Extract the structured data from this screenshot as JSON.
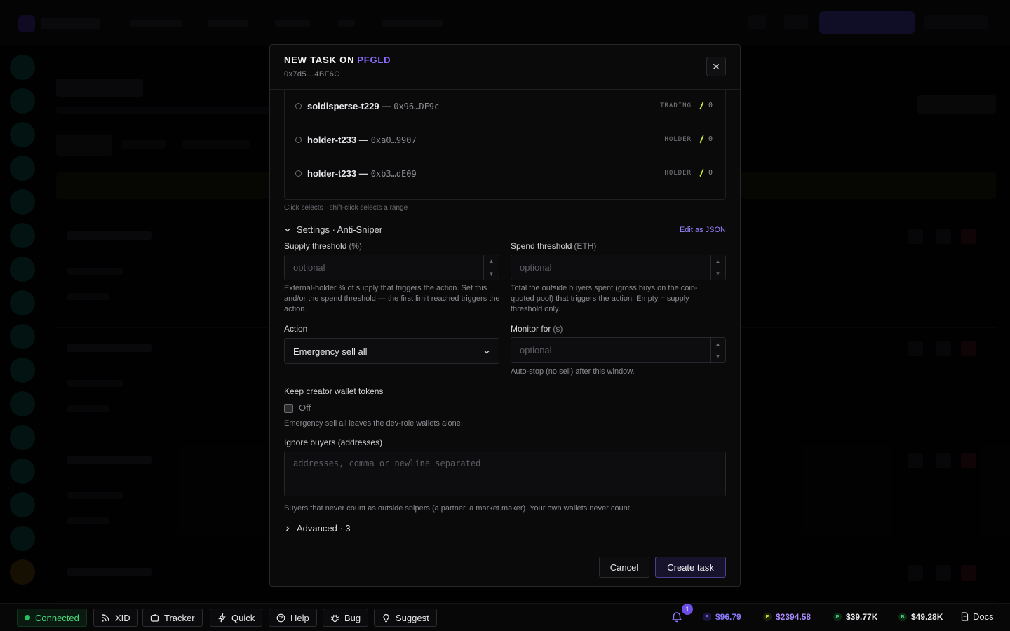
{
  "modal": {
    "title_prefix": "NEW TASK ON",
    "ticker": "PFGLD",
    "address": "0x7d5…4BF6C",
    "close_glyph": "✕"
  },
  "wallets": [
    {
      "name": "soldisperse-t229",
      "dash": "—",
      "address": "0x96…DF9c",
      "role": "TRADING",
      "balance": "0"
    },
    {
      "name": "holder-t233",
      "dash": "—",
      "address": "0xa0…9907",
      "role": "HOLDER",
      "balance": "0"
    },
    {
      "name": "holder-t233",
      "dash": "—",
      "address": "0xb3…dE09",
      "role": "HOLDER",
      "balance": "0"
    }
  ],
  "hint": "Click selects · shift-click selects a range",
  "settings": {
    "label": "Settings · Anti-Sniper",
    "edit_json": "Edit as JSON",
    "supply_threshold": {
      "label": "Supply threshold",
      "unit": "(%)",
      "placeholder": "optional",
      "help": "External-holder % of supply that triggers the action. Set this and/or the spend threshold — the first limit reached triggers the action."
    },
    "spend_threshold": {
      "label": "Spend threshold",
      "unit": "(ETH)",
      "placeholder": "optional",
      "help": "Total the outside buyers spent (gross buys on the coin-quoted pool) that triggers the action. Empty = supply threshold only."
    },
    "action": {
      "label": "Action",
      "value": "Emergency sell all"
    },
    "monitor_for": {
      "label": "Monitor for",
      "unit": "(s)",
      "placeholder": "optional",
      "help": "Auto-stop (no sell) after this window."
    },
    "keep_creator": {
      "label": "Keep creator wallet tokens",
      "state": "Off",
      "help": "Emergency sell all leaves the dev-role wallets alone."
    },
    "ignore_buyers": {
      "label": "Ignore buyers (addresses)",
      "placeholder": "addresses, comma or newline separated",
      "help": "Buyers that never count as outside snipers (a partner, a market maker). Your own wallets never count."
    },
    "advanced": "Advanced · 3"
  },
  "footer": {
    "cancel": "Cancel",
    "create": "Create task"
  },
  "statusbar": {
    "connected": "Connected",
    "buttons": [
      "XID",
      "Tracker",
      "Quick",
      "Help",
      "Bug",
      "Suggest"
    ],
    "notif_count": "1",
    "prices": [
      {
        "value": "$96.79",
        "color": "#8b7bff",
        "icon": "S"
      },
      {
        "value": "$2394.58",
        "color": "#a78bfa",
        "icon": "E"
      },
      {
        "value": "$39.77K",
        "color": "#e6e6ea",
        "icon": "P"
      },
      {
        "value": "$49.28K",
        "color": "#e6e6ea",
        "icon": "B"
      }
    ],
    "docs": "Docs"
  },
  "colors": {
    "accent": "#8b6cff",
    "connected": "#22c55e",
    "eth_icon": "#c8f03c"
  }
}
